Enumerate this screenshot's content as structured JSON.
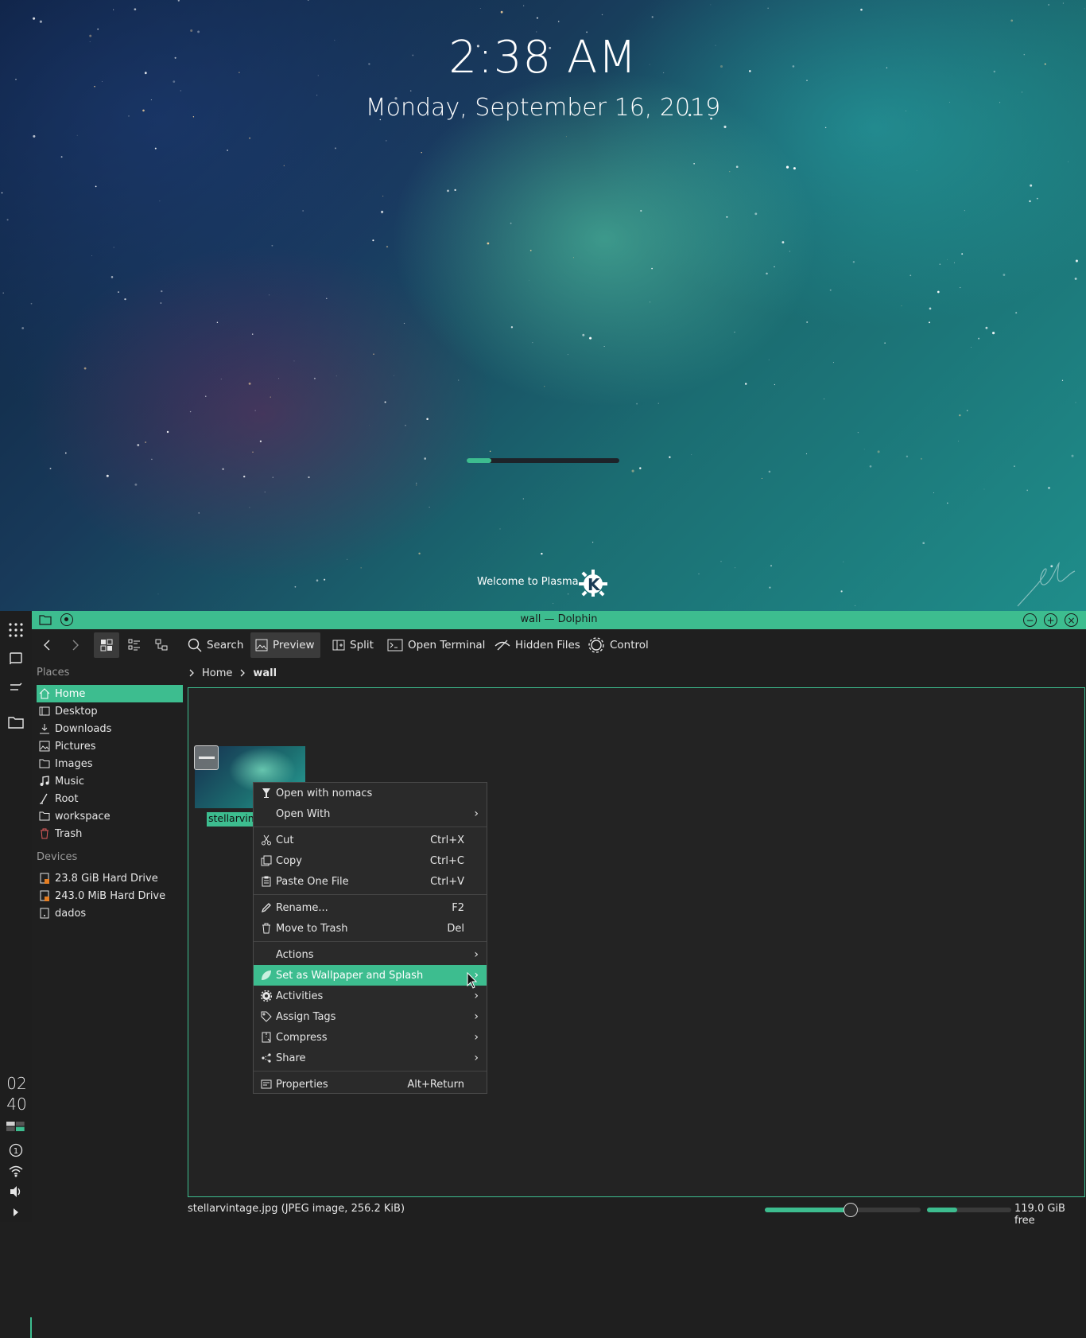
{
  "lockscreen": {
    "time": "2:38 AM",
    "date": "Monday, September 16, 2019",
    "progress": 0.16,
    "welcome": "Welcome to Plasma"
  },
  "left_panel": {
    "clock_hours": "02",
    "clock_minutes": "40",
    "info_badge": "1"
  },
  "window": {
    "title": "wall — Dolphin"
  },
  "toolbar": {
    "search": "Search",
    "preview": "Preview",
    "split": "Split",
    "open_terminal": "Open Terminal",
    "hidden_files": "Hidden Files",
    "control": "Control"
  },
  "places": {
    "title": "Places",
    "items": [
      {
        "label": "Home",
        "icon": "home-icon"
      },
      {
        "label": "Desktop",
        "icon": "desktop-icon"
      },
      {
        "label": "Downloads",
        "icon": "download-icon"
      },
      {
        "label": "Pictures",
        "icon": "pictures-icon"
      },
      {
        "label": "Images",
        "icon": "folder-icon"
      },
      {
        "label": "Music",
        "icon": "music-icon"
      },
      {
        "label": "Root",
        "icon": "root-icon"
      },
      {
        "label": "workspace",
        "icon": "folder-icon"
      },
      {
        "label": "Trash",
        "icon": "trash-icon"
      }
    ]
  },
  "devices": {
    "title": "Devices",
    "items": [
      {
        "label": "23.8 GiB Hard Drive"
      },
      {
        "label": "243.0 MiB Hard Drive"
      },
      {
        "label": "dados"
      }
    ]
  },
  "breadcrumb": {
    "home": "Home",
    "current": "wall"
  },
  "file": {
    "name_truncated": "stellarvin"
  },
  "context_menu": {
    "open_with_app": "Open with nomacs",
    "open_with": "Open With",
    "cut": "Cut",
    "cut_shortcut": "Ctrl+X",
    "copy": "Copy",
    "copy_shortcut": "Ctrl+C",
    "paste": "Paste One File",
    "paste_shortcut": "Ctrl+V",
    "rename": "Rename...",
    "rename_shortcut": "F2",
    "trash": "Move to Trash",
    "trash_shortcut": "Del",
    "actions": "Actions",
    "set_wallpaper": "Set as Wallpaper and Splash",
    "activities": "Activities",
    "assign_tags": "Assign Tags",
    "compress": "Compress",
    "share": "Share",
    "properties": "Properties",
    "properties_shortcut": "Alt+Return"
  },
  "statusbar": {
    "info": "stellarvintage.jpg (JPEG image, 256.2 KiB)",
    "zoom": 0.55,
    "disk_used": 0.36,
    "free": "119.0 GiB free"
  },
  "colors": {
    "accent": "#3dbd8f",
    "background": "#1f1f1f"
  }
}
